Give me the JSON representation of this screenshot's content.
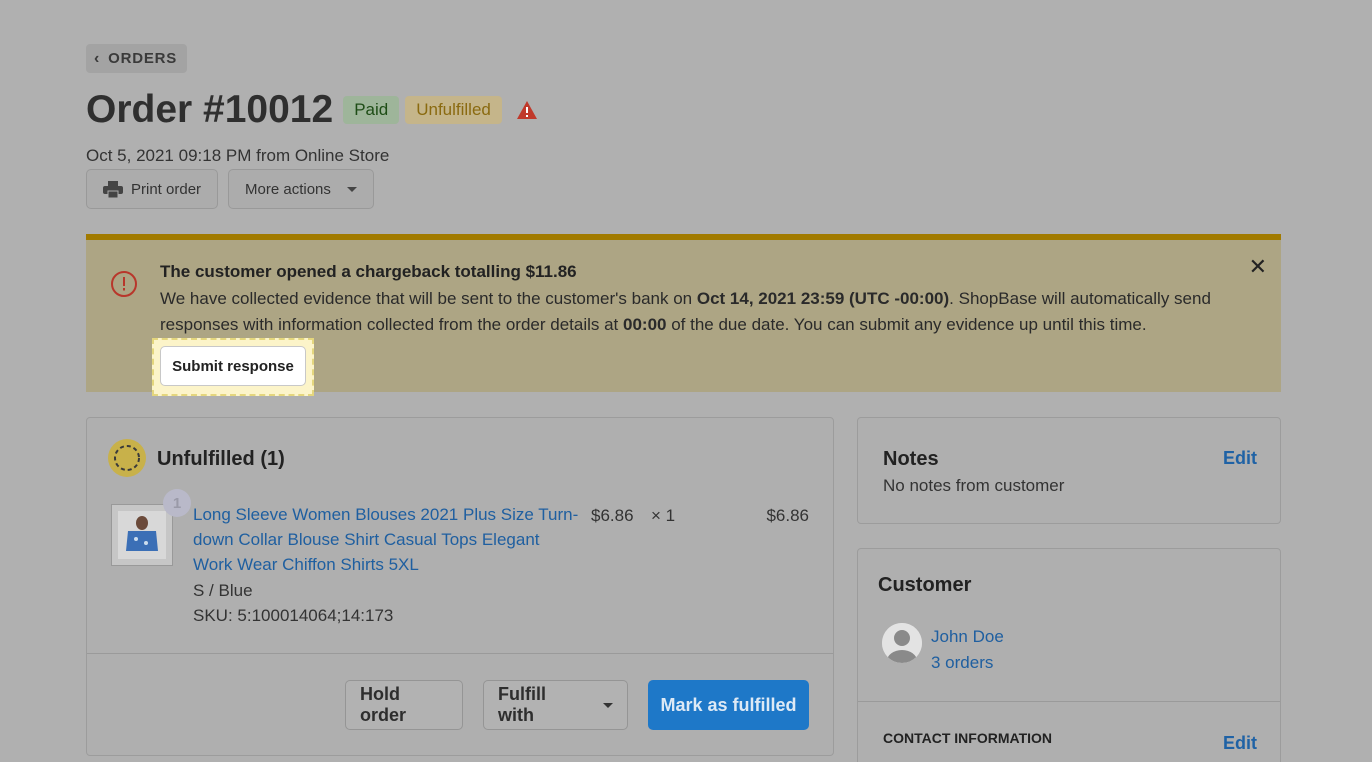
{
  "header": {
    "back_label": "ORDERS",
    "order_title": "Order #10012",
    "badges": {
      "paid": "Paid",
      "unfulfilled": "Unfulfilled"
    },
    "subline": "Oct 5, 2021 09:18 PM from Online Store",
    "actions": {
      "print": "Print order",
      "more": "More actions"
    }
  },
  "chargeback_banner": {
    "title": "The customer opened a chargeback totalling $11.86",
    "body_part1": "We have collected evidence that will be sent to the customer's bank on ",
    "body_due": "Oct 14, 2021 23:59 (UTC -00:00)",
    "body_part2": ". ShopBase will automatically send responses with information collected from the order details at ",
    "body_time": "00:00",
    "body_part3": " of the due date. You can submit any evidence up until this time.",
    "submit_label": "Submit response"
  },
  "fulfillment": {
    "title": "Unfulfilled (1)",
    "item": {
      "quantity_badge": "1",
      "name_line1": "Long Sleeve Women Blouses 2021 Plus Size Turn-",
      "name_line2": "down Collar Blouse Shirt Casual Tops Elegant",
      "name_line3": "Work Wear Chiffon Shirts 5XL",
      "variant": "S / Blue",
      "sku": "SKU: 5:100014064;14:173",
      "price": "$6.86",
      "qty": "× 1",
      "total": "$6.86"
    },
    "buttons": {
      "hold": "Hold order",
      "fulfill_with": "Fulfill with",
      "mark_fulfilled": "Mark as fulfilled"
    }
  },
  "notes": {
    "title": "Notes",
    "edit": "Edit",
    "body": "No notes from customer"
  },
  "customer": {
    "title": "Customer",
    "name": "John Doe",
    "orders": "3 orders",
    "contact_label": "CONTACT INFORMATION",
    "contact_edit": "Edit"
  },
  "colors": {
    "accent_blue": "#1e78c8",
    "banner_border": "#a17a00",
    "warning_red": "#c0392b"
  }
}
